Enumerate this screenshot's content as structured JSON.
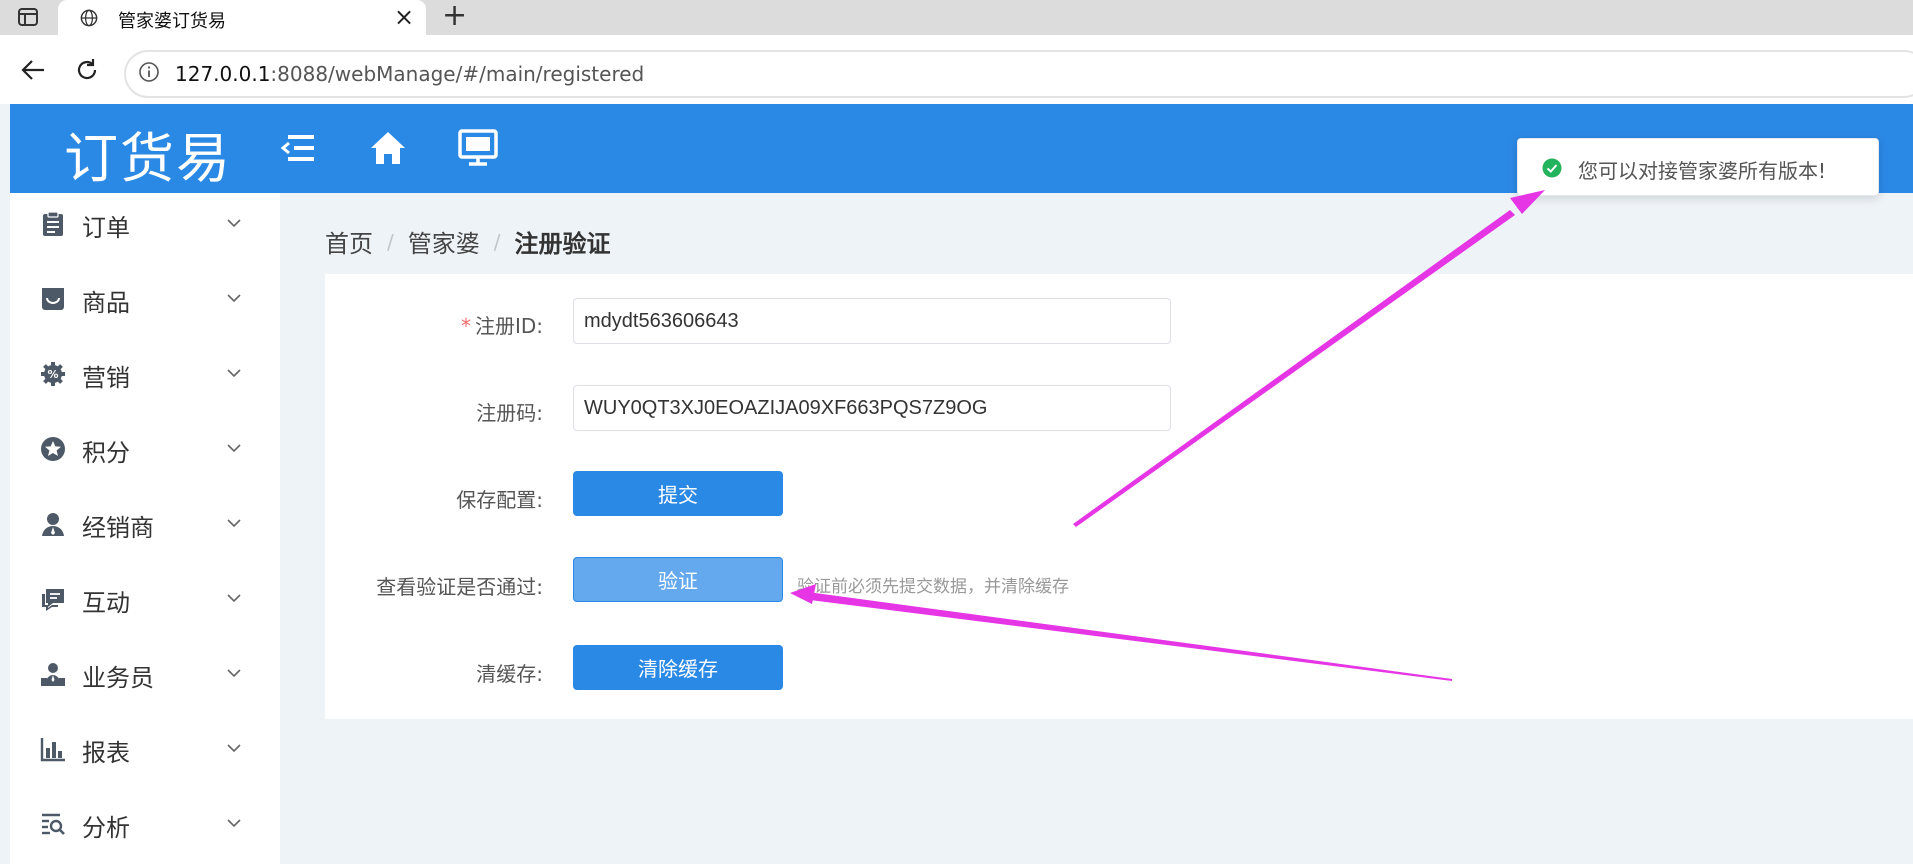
{
  "browser": {
    "tab_title": "管家婆订货易",
    "url_host": "127.0.0.1",
    "url_rest": ":8088/webManage/#/main/registered"
  },
  "header": {
    "logo_text": "订货易",
    "color": "#2b89e6"
  },
  "sidebar": {
    "items": [
      {
        "label": "订单",
        "icon": "clipboard-icon"
      },
      {
        "label": "商品",
        "icon": "basket-icon"
      },
      {
        "label": "营销",
        "icon": "discount-gear-icon"
      },
      {
        "label": "积分",
        "icon": "star-icon"
      },
      {
        "label": "经销商",
        "icon": "user-icon"
      },
      {
        "label": "互动",
        "icon": "chat-icon"
      },
      {
        "label": "业务员",
        "icon": "team-icon"
      },
      {
        "label": "报表",
        "icon": "bar-chart-icon"
      },
      {
        "label": "分析",
        "icon": "analysis-icon"
      }
    ]
  },
  "breadcrumb": {
    "home": "首页",
    "parent": "管家婆",
    "current": "注册验证",
    "separator": "/"
  },
  "form": {
    "register_id_label": "注册ID:",
    "register_id_value": "mdydt563606643",
    "register_code_label": "注册码:",
    "register_code_value": "WUY0QT3XJ0EOAZIJA09XF663PQS7Z9OG",
    "save_label": "保存配置:",
    "submit_button": "提交",
    "verify_label": "查看验证是否通过:",
    "verify_button": "验证",
    "verify_hint": "验证前必须先提交数据，并清除缓存",
    "clear_label": "清缓存:",
    "clear_button": "清除缓存"
  },
  "toast": {
    "message": "您可以对接管家婆所有版本!",
    "status_color": "#22b35e"
  },
  "annotation_color": "#e535e5"
}
